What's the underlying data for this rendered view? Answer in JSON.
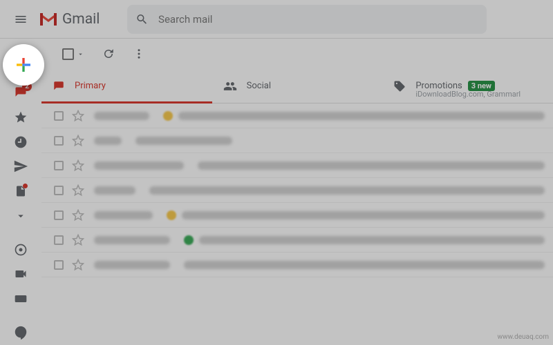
{
  "header": {
    "app_name": "Gmail",
    "search_placeholder": "Search mail"
  },
  "sidebar": {
    "inbox_badge": "2"
  },
  "tabs": {
    "primary": "Primary",
    "social": "Social",
    "promotions": "Promotions",
    "promotions_new": "3 new",
    "promotions_sub": "iDownloadBlog.com, Grammarl"
  },
  "watermark": "www.deuaq.com"
}
